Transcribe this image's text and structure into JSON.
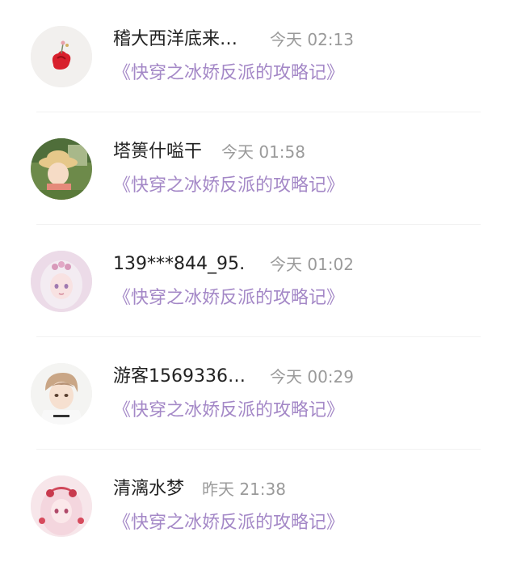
{
  "comments": [
    {
      "username": "稽大西洋底来…",
      "time": "今天 02:13",
      "book": "《快穿之冰娇反派的攻略记》",
      "avatar": "flower-avatar-icon"
    },
    {
      "username": "塔篑什嗌干",
      "time": "今天 01:58",
      "book": "《快穿之冰娇反派的攻略记》",
      "avatar": "anime-hat-girl-avatar-icon"
    },
    {
      "username": "139***844_95…",
      "time": "今天 01:02",
      "book": "《快穿之冰娇反派的攻略记》",
      "avatar": "anime-white-hair-girl-avatar-icon"
    },
    {
      "username": "游客1569336…",
      "time": "今天 00:29",
      "book": "《快穿之冰娇反派的攻略记》",
      "avatar": "anime-boy-avatar-icon"
    },
    {
      "username": "清漓水梦",
      "time": "昨天 21:38",
      "book": "《快穿之冰娇反派的攻略记》",
      "avatar": "anime-pink-girl-avatar-icon"
    }
  ],
  "colors": {
    "username": "#222222",
    "time": "#9a9a9a",
    "book": "#a488c7",
    "divider": "#f1f1f1"
  }
}
